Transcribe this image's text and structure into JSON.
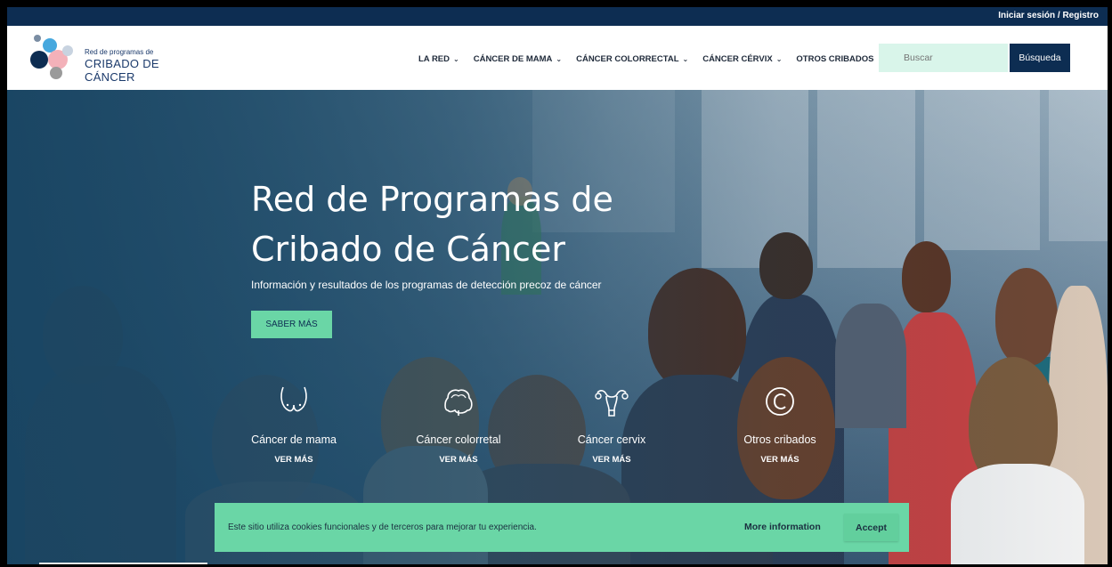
{
  "topbar": {
    "login_label": "Iniciar sesión / Registro"
  },
  "logo": {
    "small_text": "Red de programas de",
    "big_text": "CRIBADO DE CÁNCER"
  },
  "nav": [
    {
      "label": "LA RED"
    },
    {
      "label": "CÁNCER DE MAMA"
    },
    {
      "label": "CÁNCER COLORRECTAL"
    },
    {
      "label": "CÁNCER CÉRVIX"
    },
    {
      "label": "OTROS CRIBADOS"
    }
  ],
  "search": {
    "placeholder": "Buscar",
    "button_label": "Búsqueda"
  },
  "hero": {
    "title_line1": "Red de Programas de",
    "title_line2": "Cribado de Cáncer",
    "subtitle": "Información y resultados de los programas de detección precoz de cáncer",
    "cta_label": "SABER MÁS"
  },
  "categories": [
    {
      "name": "Cáncer de mama",
      "more": "VER MÁS",
      "icon": "breast-icon"
    },
    {
      "name": "Cáncer colorretal",
      "more": "VER MÁS",
      "icon": "colon-icon"
    },
    {
      "name": "Cáncer cervix",
      "more": "VER MÁS",
      "icon": "uterus-icon"
    },
    {
      "name": "Otros cribados",
      "more": "VER MÁS",
      "icon": "copyright-circle-icon"
    }
  ],
  "cookie": {
    "message": "Este sitio utiliza cookies funcionales y de terceros para mejorar tu experiencia.",
    "more_label": "More information",
    "accept_label": "Accept"
  },
  "colors": {
    "navy": "#0d2d52",
    "mint": "#6ad6a6",
    "search_bg": "#d9f5ea"
  }
}
